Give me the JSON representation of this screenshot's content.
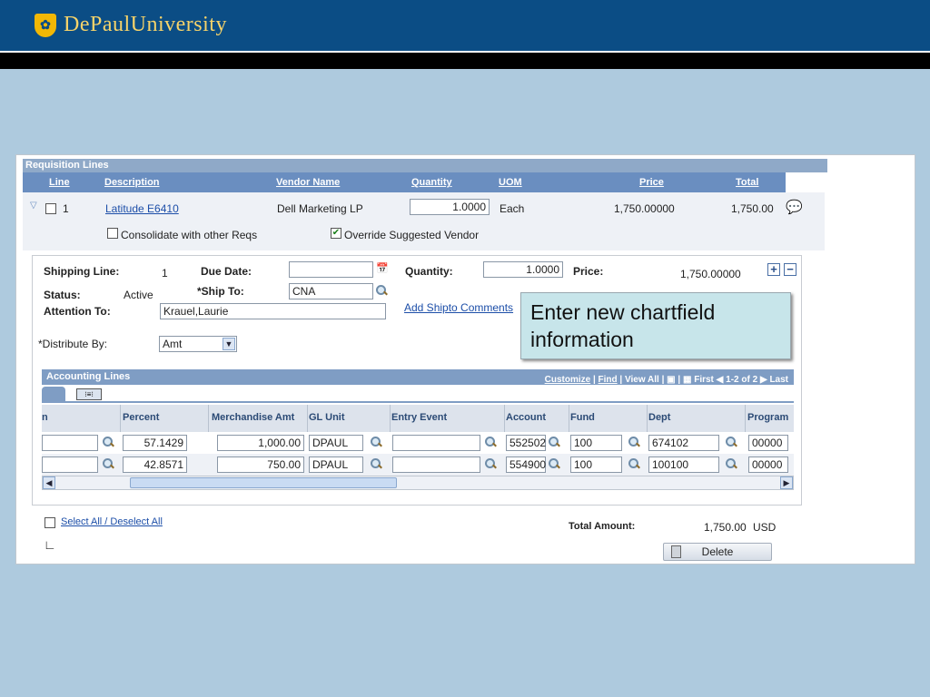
{
  "brand": {
    "name": "DePaulUniversity"
  },
  "req_lines": {
    "title": "Requisition Lines",
    "headers": {
      "line": "Line",
      "description": "Description",
      "vendor": "Vendor Name",
      "quantity": "Quantity",
      "uom": "UOM",
      "price": "Price",
      "total": "Total"
    },
    "row": {
      "line": "1",
      "description": "Latitude E6410",
      "vendor": "Dell Marketing LP",
      "quantity": "1.0000",
      "uom": "Each",
      "price": "1,750.00000",
      "total": "1,750.00"
    },
    "consolidate_label": "Consolidate with other Reqs",
    "override_label": "Override Suggested Vendor"
  },
  "shipping": {
    "shipping_line_label": "Shipping Line:",
    "shipping_line_value": "1",
    "due_date_label": "Due Date:",
    "due_date_value": "",
    "quantity_label": "Quantity:",
    "quantity_value": "1.0000",
    "price_label": "Price:",
    "price_value": "1,750.00000",
    "status_label": "Status:",
    "status_value": "Active",
    "ship_to_label": "*Ship To:",
    "ship_to_value": "CNA",
    "attention_label": "Attention To:",
    "attention_value": "Krauel,Laurie",
    "add_shipto_comments": "Add Shipto Comments",
    "distribute_label": "*Distribute By:",
    "distribute_value": "Amt"
  },
  "callout": "Enter new chartfield information",
  "accounting": {
    "title": "Accounting Lines",
    "tools": {
      "customize": "Customize",
      "find": "Find",
      "view_all": "View All",
      "first": "First",
      "range": "1-2 of 2",
      "last": "Last"
    },
    "headers": {
      "n": "n",
      "percent": "Percent",
      "merch": "Merchandise Amt",
      "gl_unit": "GL Unit",
      "entry_event": "Entry Event",
      "account": "Account",
      "fund": "Fund",
      "dept": "Dept",
      "program": "Program"
    },
    "rows": [
      {
        "percent": "57.1429",
        "merch": "1,000.00",
        "gl_unit": "DPAUL",
        "entry_event": "",
        "account": "552502",
        "fund": "100",
        "dept": "674102",
        "program": "00000"
      },
      {
        "percent": "42.8571",
        "merch": "750.00",
        "gl_unit": "DPAUL",
        "entry_event": "",
        "account": "554900",
        "fund": "100",
        "dept": "100100",
        "program": "00000"
      }
    ]
  },
  "footer": {
    "select_all": "Select All / Deselect All",
    "total_label": "Total Amount:",
    "total_value": "1,750.00",
    "currency": "USD",
    "delete_button": "Delete"
  }
}
